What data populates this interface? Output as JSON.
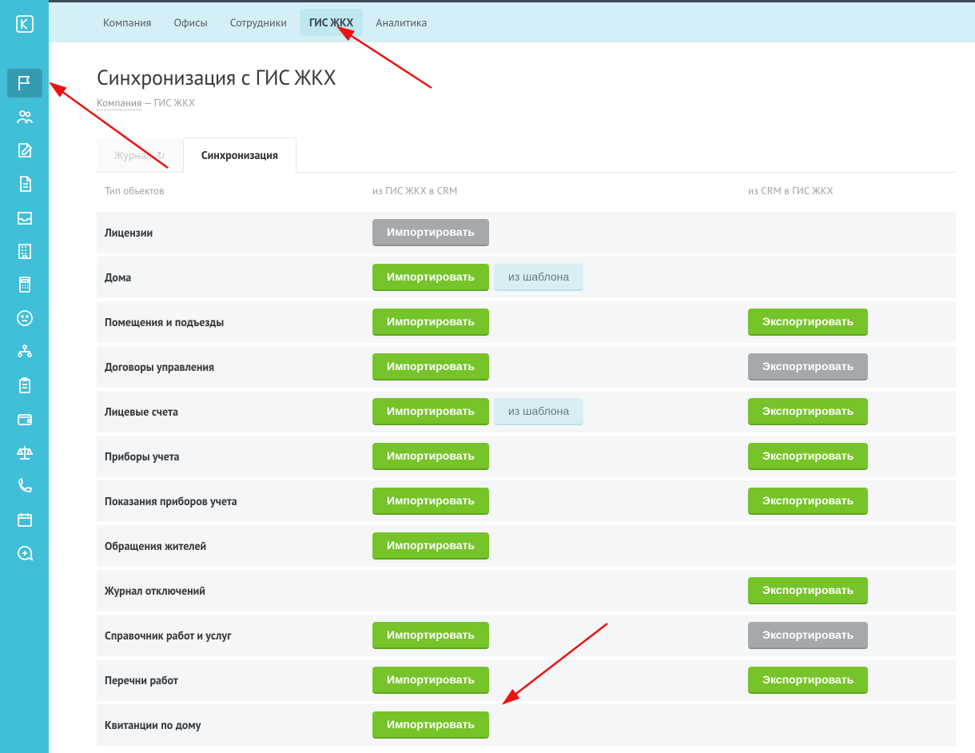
{
  "topnav": [
    "Компания",
    "Офисы",
    "Сотрудники",
    "ГИС ЖКХ",
    "Аналитика"
  ],
  "topnav_active": 3,
  "title": "Синхронизация с ГИС ЖКХ",
  "breadcrumb": {
    "link": "Компания",
    "sep": " — ",
    "current": "ГИС ЖКХ"
  },
  "tabs": {
    "journal": "Журнал",
    "sync": "Синхронизация"
  },
  "headers": {
    "type": "Тип объектов",
    "import": "из ГИС ЖКХ в CRM",
    "export": "из CRM в ГИС ЖКХ"
  },
  "btn": {
    "import": "Импортировать",
    "export": "Экспортировать",
    "template": "из шаблона"
  },
  "rows": [
    {
      "name": "Лицензии",
      "import": "disabled",
      "template": false,
      "export": null
    },
    {
      "name": "Дома",
      "import": "green",
      "template": true,
      "export": null
    },
    {
      "name": "Помещения и подъезды",
      "import": "green",
      "template": false,
      "export": "green"
    },
    {
      "name": "Договоры управления",
      "import": "green",
      "template": false,
      "export": "disabled"
    },
    {
      "name": "Лицевые счета",
      "import": "green",
      "template": true,
      "export": "green"
    },
    {
      "name": "Приборы учета",
      "import": "green",
      "template": false,
      "export": "green"
    },
    {
      "name": "Показания приборов учета",
      "import": "green",
      "template": false,
      "export": "green"
    },
    {
      "name": "Обращения жителей",
      "import": "green",
      "template": false,
      "export": null
    },
    {
      "name": "Журнал отключений",
      "import": null,
      "template": false,
      "export": "green"
    },
    {
      "name": "Справочник работ и услуг",
      "import": "green",
      "template": false,
      "export": "disabled"
    },
    {
      "name": "Перечни работ",
      "import": "green",
      "template": false,
      "export": "green"
    },
    {
      "name": "Квитанции по дому",
      "import": "green",
      "template": false,
      "export": null
    }
  ],
  "sidebar_icons": [
    "logo",
    "flag",
    "users",
    "edit",
    "document",
    "inbox",
    "building",
    "calculator",
    "sad-face",
    "org",
    "clipboard",
    "wallet",
    "scales",
    "phone",
    "calendar",
    "chat-plus"
  ]
}
